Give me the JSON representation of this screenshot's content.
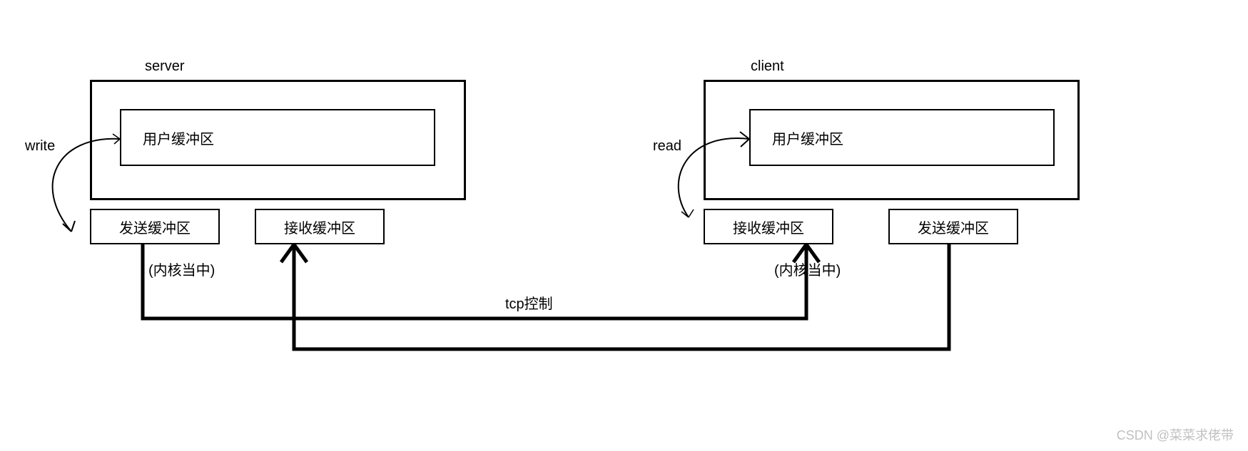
{
  "server": {
    "title": "server",
    "userBuffer": "用户缓冲区",
    "sendBuffer": "发送缓冲区",
    "recvBuffer": "接收缓冲区",
    "kernelNote": "(内核当中)",
    "writeLabel": "write"
  },
  "client": {
    "title": "client",
    "userBuffer": "用户缓冲区",
    "sendBuffer": "发送缓冲区",
    "recvBuffer": "接收缓冲区",
    "kernelNote": "(内核当中)",
    "readLabel": "read"
  },
  "tcpLabel": "tcp控制",
  "watermark": "CSDN @菜菜求佬带"
}
